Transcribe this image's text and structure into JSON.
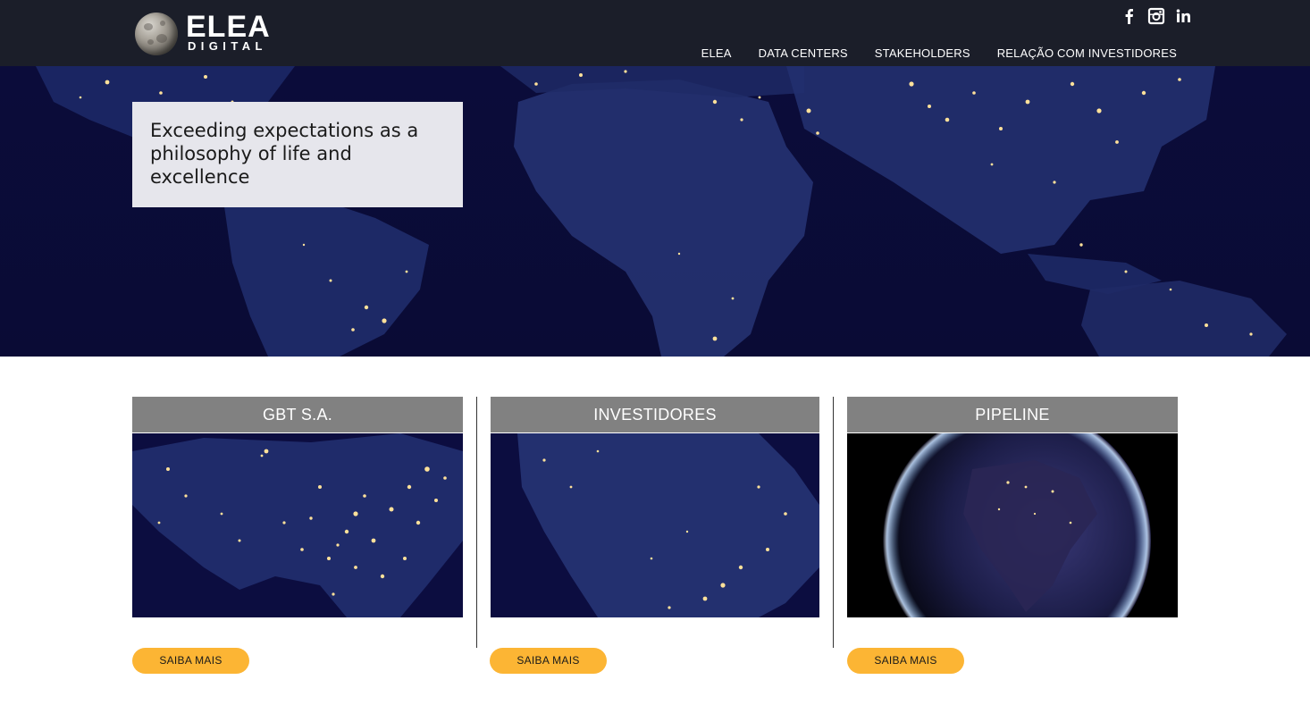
{
  "brand": {
    "name": "ELEA",
    "subtitle": "DIGITAL"
  },
  "social": [
    {
      "name": "facebook-icon"
    },
    {
      "name": "instagram-icon"
    },
    {
      "name": "linkedin-icon"
    }
  ],
  "nav": {
    "items": [
      "ELEA",
      "DATA CENTERS",
      "STAKEHOLDERS",
      "RELAÇÃO COM INVESTIDORES"
    ]
  },
  "hero": {
    "tagline_lines": [
      "Exceeding expectations as a",
      "philosophy of life and",
      "excellence"
    ]
  },
  "cards": [
    {
      "title": "GBT S.A.",
      "button": "SAIBA MAIS",
      "image": "north-america-night-lights"
    },
    {
      "title": "INVESTIDORES",
      "button": "SAIBA MAIS",
      "image": "south-america-night-lights"
    },
    {
      "title": "PIPELINE",
      "button": "SAIBA MAIS",
      "image": "earth-globe-night"
    }
  ],
  "colors": {
    "header_bg": "#1b1e29",
    "night_blue": "#0b0c3a",
    "city_light": "#ffe19a",
    "card_title_bg": "#818181",
    "button_bg": "#fcb534"
  }
}
